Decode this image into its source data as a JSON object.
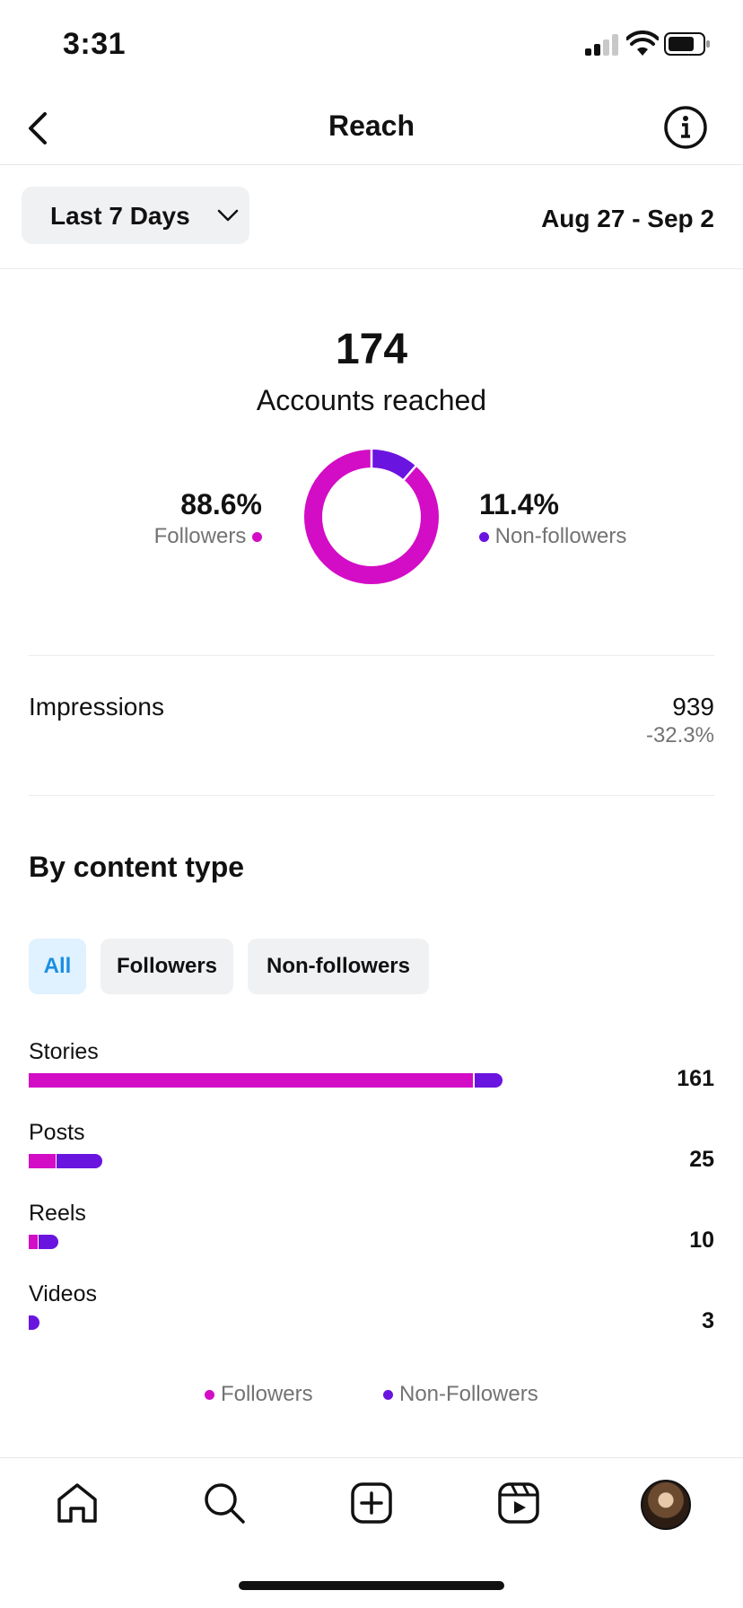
{
  "status_bar": {
    "time": "3:31"
  },
  "header": {
    "title": "Reach"
  },
  "date_filter": {
    "selected": "Last 7 Days",
    "range": "Aug 27 - Sep 2"
  },
  "reach": {
    "count": "174",
    "label": "Accounts reached",
    "followers_pct": "88.6%",
    "followers_label": "Followers",
    "non_followers_pct": "11.4%",
    "non_followers_label": "Non-followers",
    "followers_fraction": 0.886
  },
  "impressions": {
    "label": "Impressions",
    "value": "939",
    "change": "-32.3%"
  },
  "content_type": {
    "title": "By content type",
    "filters": [
      "All",
      "Followers",
      "Non-followers"
    ],
    "active_filter": "All",
    "rows": [
      {
        "label": "Stories",
        "value": "161"
      },
      {
        "label": "Posts",
        "value": "25"
      },
      {
        "label": "Reels",
        "value": "10"
      },
      {
        "label": "Videos",
        "value": "3"
      }
    ],
    "legend": [
      "Followers",
      "Non-Followers"
    ]
  },
  "chart_data": {
    "type": "bar",
    "categories": [
      "Stories",
      "Posts",
      "Reels",
      "Videos"
    ],
    "series": [
      {
        "name": "Followers",
        "values": [
          151,
          9,
          3,
          0
        ]
      },
      {
        "name": "Non-Followers",
        "values": [
          10,
          16,
          7,
          3
        ]
      }
    ],
    "totals": [
      161,
      25,
      10,
      3
    ]
  },
  "colors": {
    "followers": "#d30cc6",
    "non_followers": "#6a14e0",
    "active_chip": "#1a8fe3"
  },
  "tab_bar": {
    "icons": [
      "home-icon",
      "search-icon",
      "create-icon",
      "reels-icon",
      "profile-avatar"
    ]
  }
}
